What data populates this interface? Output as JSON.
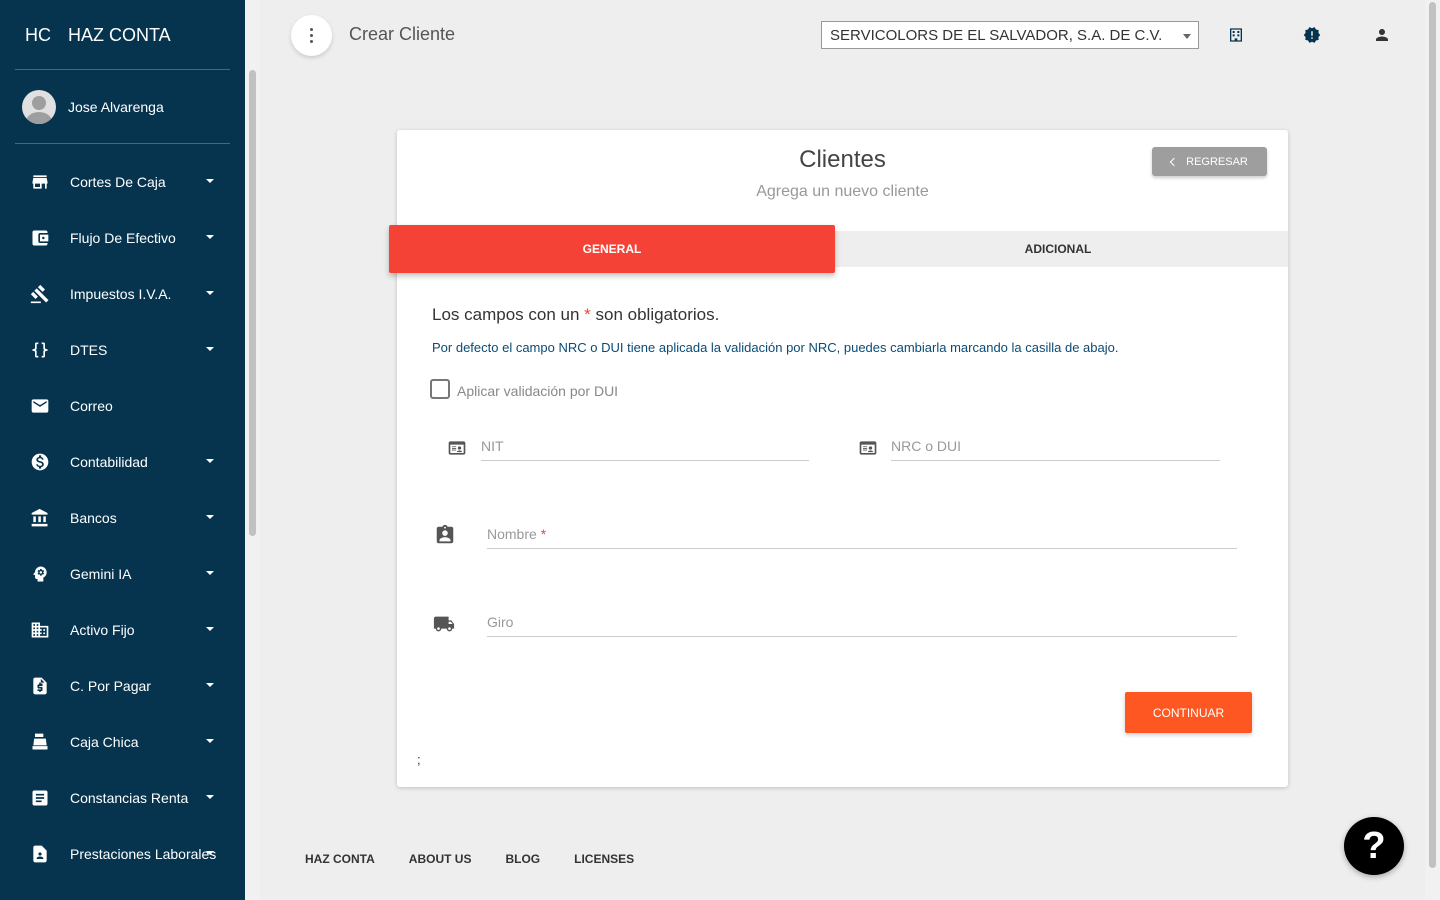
{
  "app": {
    "logo_mini": "HC",
    "logo_text": "HAZ CONTA"
  },
  "user": {
    "name": "Jose Alvarenga"
  },
  "sidebar": {
    "items": [
      {
        "label": "Cortes De Caja",
        "icon": "store-icon",
        "has_caret": true
      },
      {
        "label": "Flujo De Efectivo",
        "icon": "wallet-icon",
        "has_caret": true
      },
      {
        "label": "Impuestos I.V.A.",
        "icon": "gavel-icon",
        "has_caret": true
      },
      {
        "label": "DTES",
        "icon": "braces-icon",
        "has_caret": true
      },
      {
        "label": "Correo",
        "icon": "mail-icon",
        "has_caret": false
      },
      {
        "label": "Contabilidad",
        "icon": "dollar-circle-icon",
        "has_caret": true
      },
      {
        "label": "Bancos",
        "icon": "bank-icon",
        "has_caret": true
      },
      {
        "label": "Gemini IA",
        "icon": "brain-head-icon",
        "has_caret": true
      },
      {
        "label": "Activo Fijo",
        "icon": "building-icon",
        "has_caret": true
      },
      {
        "label": "C. Por Pagar",
        "icon": "invoice-icon",
        "has_caret": true
      },
      {
        "label": "Caja Chica",
        "icon": "cash-register-icon",
        "has_caret": true
      },
      {
        "label": "Constancias Renta",
        "icon": "document-icon",
        "has_caret": true
      },
      {
        "label": "Prestaciones Laborales",
        "icon": "badge-icon",
        "has_caret": true
      }
    ]
  },
  "header": {
    "title": "Crear Cliente",
    "company_select": {
      "value": "SERVICOLORS DE EL SALVADOR, S.A. DE C.V."
    }
  },
  "card": {
    "title": "Clientes",
    "subtitle": "Agrega un nuevo cliente",
    "back_label": "REGRESAR",
    "tabs": [
      {
        "label": "GENERAL",
        "active": true
      },
      {
        "label": "ADICIONAL",
        "active": false
      }
    ],
    "required_note_before": "Los campos con un",
    "required_star": "*",
    "required_note_after": "son obligatorios.",
    "info_note": "Por defecto el campo NRC o DUI tiene aplicada la validación por NRC, puedes cambiarla marcando la casilla de abajo.",
    "checkbox_label": "Aplicar validación por DUI",
    "checkbox_checked": false,
    "fields": {
      "nit": {
        "label": "NIT",
        "value": ""
      },
      "nrc": {
        "label": "NRC o DUI",
        "value": ""
      },
      "nombre": {
        "label": "Nombre",
        "required_star": "*",
        "value": ""
      },
      "giro": {
        "label": "Giro",
        "value": ""
      }
    },
    "continue_label": "CONTINUAR",
    "stray_text": ";"
  },
  "footer": {
    "links": [
      "HAZ CONTA",
      "ABOUT US",
      "BLOG",
      "LICENSES"
    ]
  },
  "help": {
    "label": "?"
  },
  "colors": {
    "sidebar_bg": "#06344f",
    "tab_active": "#f44336",
    "continue_button": "#ff5722",
    "info_text": "#0b4b75"
  }
}
